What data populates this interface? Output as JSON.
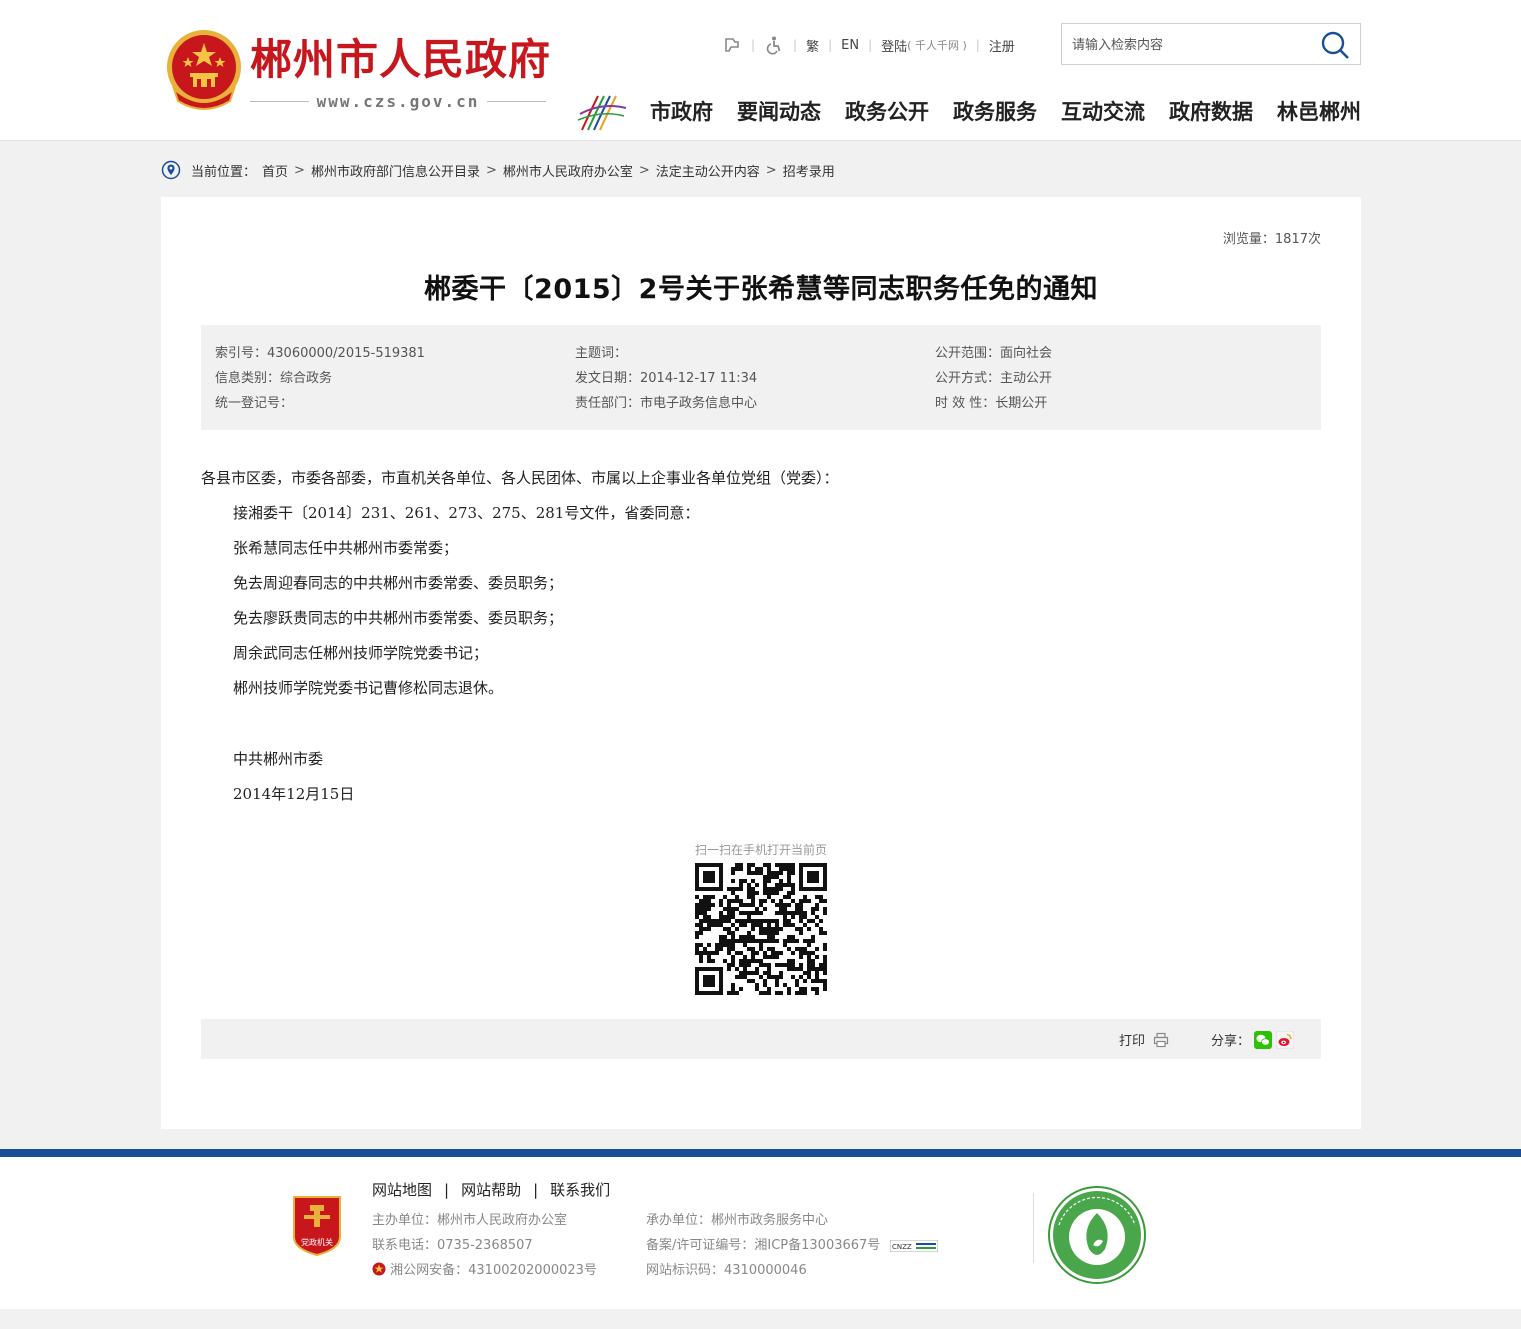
{
  "header": {
    "site_title": "郴州市人民政府",
    "site_url": "www.czs.gov.cn",
    "toplinks": {
      "traditional": "繁",
      "english": "EN",
      "login": "登陆",
      "login_note": "( 千人千网 )",
      "register": "注册"
    },
    "search": {
      "placeholder": "请输入检索内容"
    },
    "nav": [
      "市政府",
      "要闻动态",
      "政务公开",
      "政务服务",
      "互动交流",
      "政府数据",
      "林邑郴州"
    ]
  },
  "breadcrumb": {
    "label": "当前位置：",
    "items": [
      "首页",
      "郴州市政府部门信息公开目录",
      "郴州市人民政府办公室",
      "法定主动公开内容",
      "招考录用"
    ]
  },
  "article": {
    "views": "浏览量：1817次",
    "title": "郴委干〔2015〕2号关于张希慧等同志职务任免的通知",
    "meta": {
      "index_no": "索引号：43060000/2015-519381",
      "category": "信息类别：综合政务",
      "reg_no": "统一登记号：",
      "subject": "主题词：",
      "date": "发文日期：2014-12-17 11:34",
      "dept": "责任部门：市电子政务信息中心",
      "scope": "公开范围：面向社会",
      "method": "公开方式：主动公开",
      "validity": "时 效 性：长期公开"
    },
    "body": [
      "各县市区委，市委各部委，市直机关各单位、各人民团体、市属以上企事业各单位党组（党委）：",
      "接湘委干〔2014〕231、261、273、275、281号文件，省委同意：",
      "张希慧同志任中共郴州市委常委；",
      "免去周迎春同志的中共郴州市委常委、委员职务；",
      "免去廖跃贵同志的中共郴州市委常委、委员职务；",
      "周余武同志任郴州技师学院党委书记；",
      "郴州技师学院党委书记曹修松同志退休。"
    ],
    "signature": "中共郴州市委",
    "sign_date": "2014年12月15日",
    "qr_label": "扫一扫在手机打开当前页",
    "print_label": "打印",
    "share_label": "分享："
  },
  "footer": {
    "links": [
      "网站地图",
      "网站帮助",
      "联系我们"
    ],
    "host": "主办单位：郴州市人民政府办公室",
    "phone": "联系电话：0735-2368507",
    "police": "湘公网安备：43100202000023号",
    "organizer": "承办单位：郴州市政务服务中心",
    "icp": "备案/许可证编号：湘ICP备13003667号",
    "site_id": "网站标识码：4310000046",
    "badge_text": "党政机关",
    "cnzz_text": "CNZZ"
  },
  "colors": {
    "brand_red": "#c8161d",
    "footer_blue": "#1a4f98",
    "panel_gray": "#f1f1f1"
  }
}
